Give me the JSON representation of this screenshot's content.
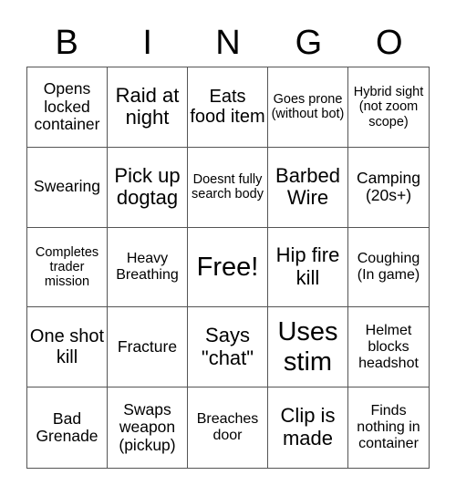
{
  "header": [
    "B",
    "I",
    "N",
    "G",
    "O"
  ],
  "cells": [
    "Opens locked container",
    "Raid at night",
    "Eats food item",
    "Goes prone (without bot)",
    "Hybrid sight (not zoom scope)",
    "Swearing",
    "Pick up dogtag",
    "Doesnt fully search body",
    "Barbed Wire",
    "Camping (20s+)",
    "Completes trader mission",
    "Heavy Breathing",
    "Free!",
    "Hip fire kill",
    "Coughing (In game)",
    "One shot kill",
    "Fracture",
    "Says \"chat\"",
    "Uses stim",
    "Helmet blocks headshot",
    "Bad Grenade",
    "Swaps weapon (pickup)",
    "Breaches door",
    "Clip is made",
    "Finds nothing in container"
  ]
}
